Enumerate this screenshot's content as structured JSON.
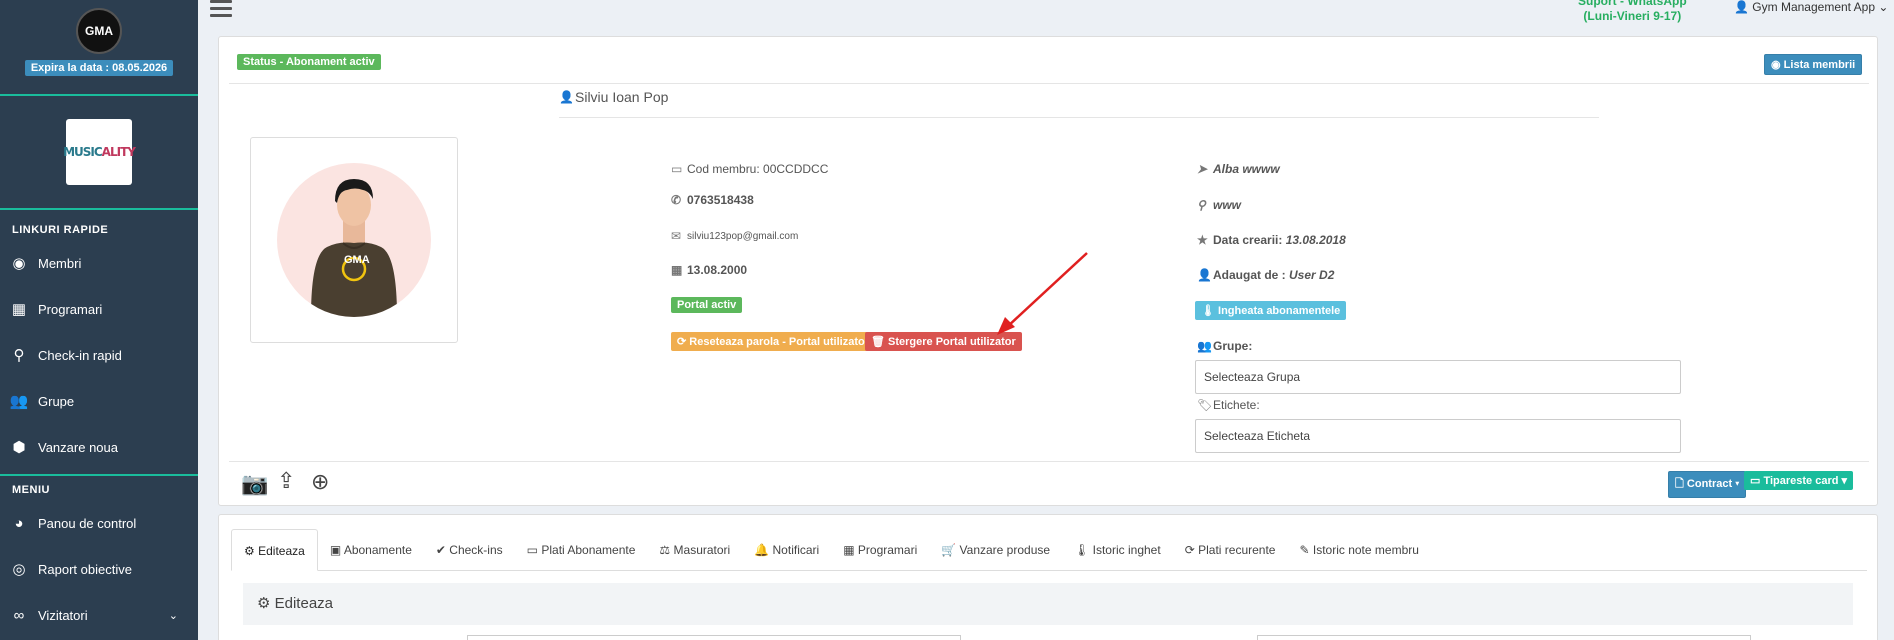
{
  "sidebar": {
    "logo_text": "GMA",
    "expiry_label": "Expira la data : 08.05.2026",
    "brand_text_a": "MUSIC",
    "brand_text_b": "ALITY",
    "quick_links_title": "LINKURI RAPIDE",
    "quick_links": [
      {
        "label": "Membri",
        "icon": "user-circle-icon"
      },
      {
        "label": "Programari",
        "icon": "calendar-icon"
      },
      {
        "label": "Check-in rapid",
        "icon": "map-marker-icon"
      },
      {
        "label": "Grupe",
        "icon": "users-icon"
      },
      {
        "label": "Vanzare noua",
        "icon": "cube-icon"
      }
    ],
    "menu_title": "MENIU",
    "menu": [
      {
        "label": "Panou de control",
        "icon": "dashboard-icon"
      },
      {
        "label": "Raport obiective",
        "icon": "target-icon"
      },
      {
        "label": "Vizitatori",
        "icon": "binoculars-icon"
      }
    ]
  },
  "topbar": {
    "support_line1": "Suport - WhatsApp",
    "support_line2": "(Luni-Vineri 9-17)",
    "user_label": "Gym Management App"
  },
  "profile": {
    "status_badge": "Status - Abonament activ",
    "members_list_button": "Lista membrii",
    "name": "Silviu Ioan Pop",
    "member_code": "Cod membru: 00CCDDCC",
    "phone": "0763518438",
    "email": "silviu123pop@gmail.com",
    "birth_date": "13.08.2000",
    "portal_badge": "Portal activ",
    "reset_password_button": "Reseteaza parola - Portal utilizator",
    "delete_portal_button": "Stergere Portal utilizator",
    "city": "Alba wwww",
    "address": "www",
    "created_label": "Data crearii:",
    "created_value": "13.08.2018",
    "added_by_label": "Adaugat de :",
    "added_by_value": "User D2",
    "freeze_button": "Ingheata abonamentele",
    "groups_label": "Grupe:",
    "groups_placeholder": "Selecteaza Grupa",
    "tags_label": "Etichete:",
    "tags_placeholder": "Selecteaza Eticheta",
    "contract_button": "Contract",
    "print_card_button": "Tipareste card",
    "avatar_logo": "GMA"
  },
  "tabs": [
    {
      "label": "Editeaza",
      "icon": "gear-icon"
    },
    {
      "label": "Abonamente",
      "icon": "id-card-icon"
    },
    {
      "label": "Check-ins",
      "icon": "check-icon"
    },
    {
      "label": "Plati Abonamente",
      "icon": "credit-card-icon"
    },
    {
      "label": "Masuratori",
      "icon": "balance-scale-icon"
    },
    {
      "label": "Notificari",
      "icon": "bell-icon"
    },
    {
      "label": "Programari",
      "icon": "calendar-icon"
    },
    {
      "label": "Vanzare produse",
      "icon": "cart-icon"
    },
    {
      "label": "Istoric inghet",
      "icon": "thermometer-icon"
    },
    {
      "label": "Plati recurente",
      "icon": "refresh-icon"
    },
    {
      "label": "Istoric note membru",
      "icon": "pencil-icon"
    }
  ],
  "edit_panel_title": "Editeaza",
  "colors": {
    "sidebar_bg": "#2c3e50",
    "accent_teal": "#1abc9c",
    "primary_blue": "#3c8dbc",
    "success_green": "#5cb85c",
    "danger_red": "#d9534f",
    "warning_orange": "#f0ad4e",
    "annotation_arrow": "#e02020"
  }
}
